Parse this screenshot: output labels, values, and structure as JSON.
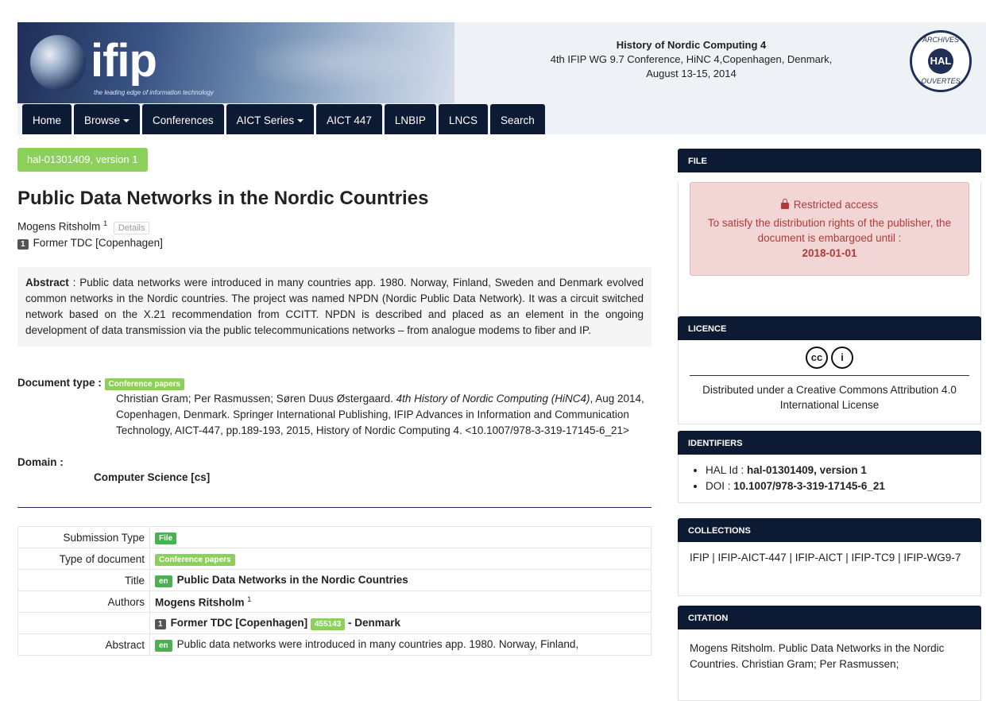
{
  "header": {
    "logo_text": "ifip",
    "logo_tagline": "the leading edge of information technology",
    "conf_title": "History of Nordic Computing 4",
    "conf_line2": "4th IFIP WG 9.7 Conference, HiNC 4,Copenhagen, Denmark,",
    "conf_line3": "August 13-15, 2014",
    "hal_logo_top": "ARCHIVES",
    "hal_logo_center": "HAL",
    "hal_logo_bottom": "OUVERTES"
  },
  "nav": [
    "Home",
    "Browse",
    "Conferences",
    "AICT Series",
    "AICT 447",
    "LNBIP",
    "LNCS",
    "Search"
  ],
  "doc": {
    "version": "hal-01301409, version 1",
    "title": "Public Data Networks in the Nordic Countries",
    "author": "Mogens Ritsholm",
    "author_sup": "1",
    "details": "Details",
    "affil_num": "1",
    "affil": "Former TDC [Copenhagen]",
    "abstract_label": "Abstract",
    "abstract": "Public data networks were introduced in many countries app. 1980. Norway, Finland, Sweden and Denmark evolved common networks in the Nordic countries. The project was named NPDN (Nordic Public Data Network). It was a circuit switched network based on the X.21 recommendation from CCITT. NPDN is described and placed as an element in the ongoing development of data transmission via the public telecommunications networks – from analogue modems to fiber and IP.",
    "doctype_label": "Document type :",
    "doctype_badge": "Conference papers",
    "citation_pre": "Christian Gram; Per Rasmussen; Søren Duus Østergaard. ",
    "citation_em": "4th History of Nordic Computing (HiNC4)",
    "citation_post": ", Aug 2014, Copenhagen, Denmark. Springer International Publishing, IFIP Advances in Information and Communication Technology, AICT-447, pp.189-193, 2015, History of Nordic Computing 4. <10.1007/978-3-319-17145-6_21>",
    "domain_label": "Domain :",
    "domain": "Computer Science [cs]"
  },
  "meta": {
    "submission_type_k": "Submission Type",
    "submission_type_v": "File",
    "type_doc_k": "Type of document",
    "type_doc_v": "Conference papers",
    "title_k": "Title",
    "title_lang": "en",
    "title_v": "Public Data Networks in the Nordic Countries",
    "authors_k": "Authors",
    "authors_v": "Mogens Ritsholm",
    "authors_sup": "1",
    "affil_num": "1",
    "affil_v": "Former TDC [Copenhagen]",
    "affil_id": "455143",
    "affil_country": "- Denmark",
    "abstract_k": "Abstract",
    "abstract_lang": "en",
    "abstract_v": "Public data networks were introduced in many countries app. 1980. Norway, Finland,"
  },
  "sidebar": {
    "file_h": "FILE",
    "restricted_title": "Restricted access",
    "restricted_text": "To satisfy the distribution rights of the publisher, the document is embargoed until :",
    "restricted_date": "2018-01-01",
    "licence_h": "LICENCE",
    "licence_text": "Distributed under a Creative Commons Attribution 4.0 International License",
    "identifiers_h": "IDENTIFIERS",
    "hal_id_label": "HAL Id :",
    "hal_id": "hal-01301409, version 1",
    "doi_label": "DOI :",
    "doi": "10.1007/978-3-319-17145-6_21",
    "collections_h": "COLLECTIONS",
    "collections": "IFIP | IFIP-AICT-447 | IFIP-AICT | IFIP-TC9 | IFIP-WG9-7",
    "citation_h": "CITATION",
    "citation": "Mogens Ritsholm. Public Data Networks in the Nordic Countries. Christian Gram; Per Rasmussen;"
  }
}
